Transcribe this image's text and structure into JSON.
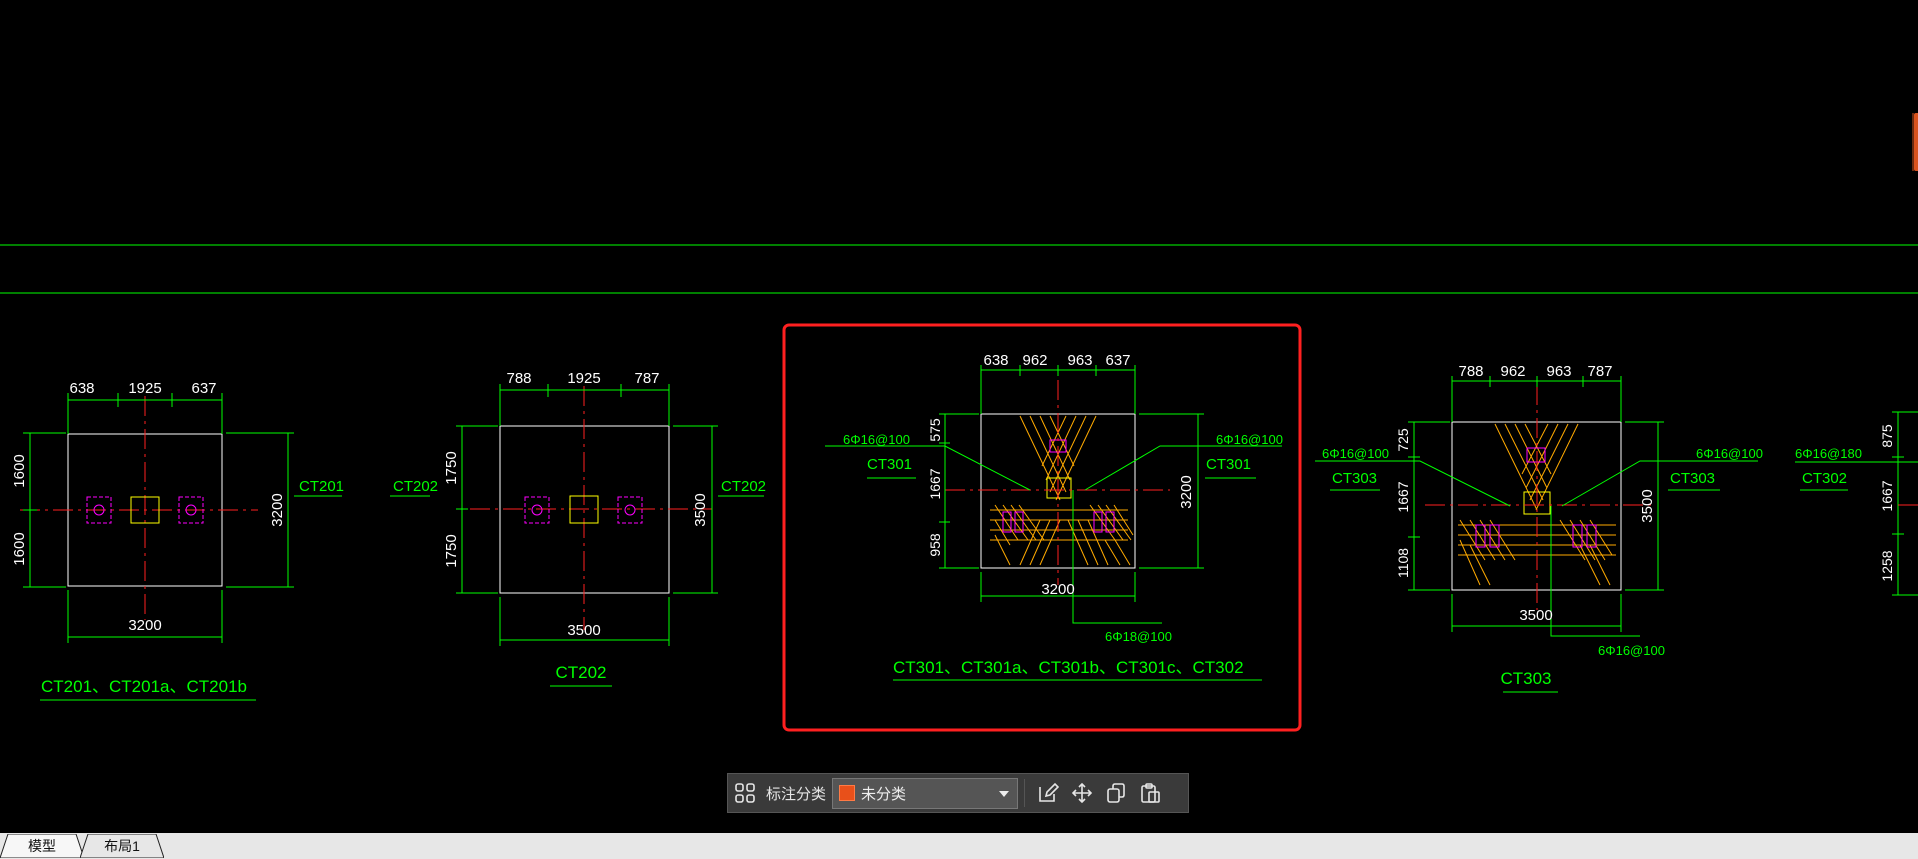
{
  "drawing": {
    "ct201": {
      "dims_top": [
        "638",
        "1925",
        "637"
      ],
      "dims_left": [
        "1600",
        "1600"
      ],
      "dim_right": "3200",
      "dim_bottom": "3200",
      "side_label": "CT201",
      "caption": "CT201、CT201a、CT201b"
    },
    "ct202": {
      "dims_top": [
        "788",
        "1925",
        "787"
      ],
      "dims_left": [
        "1750",
        "1750"
      ],
      "dim_right": "3500",
      "dim_bottom": "3500",
      "side_label_left": "CT202",
      "side_label_right": "CT202",
      "caption": "CT202"
    },
    "ct301": {
      "dims_top": [
        "638",
        "962",
        "963",
        "637"
      ],
      "dims_left": [
        "575",
        "1667",
        "958"
      ],
      "dim_right": "3200",
      "dim_bottom": "3200",
      "rebar_left": "6Φ16@100",
      "rebar_right": "6Φ16@100",
      "rebar_bottom": "6Φ18@100",
      "label_left": "CT301",
      "label_right": "CT301",
      "caption": "CT301、CT301a、CT301b、CT301c、CT302"
    },
    "ct303": {
      "dims_top": [
        "788",
        "962",
        "963",
        "787"
      ],
      "dims_left": [
        "725",
        "1667",
        "1108"
      ],
      "dim_right": "3500",
      "dim_bottom": "3500",
      "rebar_left": "6Φ16@100",
      "rebar_right": "6Φ16@100",
      "rebar_bottom": "6Φ16@100",
      "label_left": "CT303",
      "label_right": "CT303",
      "caption": "CT303"
    },
    "ct302": {
      "dims_left": [
        "875",
        "1667",
        "1258"
      ],
      "rebar_left": "6Φ16@180",
      "label_left": "CT302"
    }
  },
  "toolbar": {
    "label": "标注分类",
    "select_value": "未分类"
  },
  "tabs": {
    "model": "模型",
    "layout1": "布局1"
  },
  "colors": {
    "background": "#000000",
    "dimension": "#00ff00",
    "outline": "#ffffff",
    "centerline": "#ff0000",
    "pile": "#ff00ff",
    "column": "#ffff00",
    "rebar": "#ffaa00",
    "highlight": "#ff2020",
    "category_swatch": "#e8501a"
  }
}
